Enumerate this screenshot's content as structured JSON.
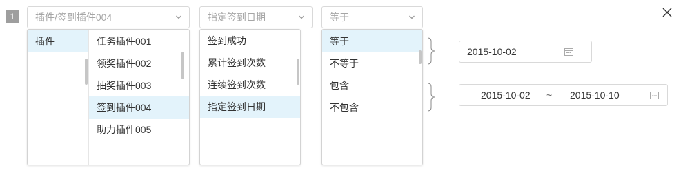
{
  "row": {
    "index": "1"
  },
  "field_select": {
    "value": "插件/签到插件004"
  },
  "field_dropdown": {
    "categories": [
      {
        "label": "插件"
      }
    ],
    "plugins": [
      {
        "label": "任务插件001"
      },
      {
        "label": "领奖插件002"
      },
      {
        "label": "抽奖插件003"
      },
      {
        "label": "签到插件004",
        "selected": true
      },
      {
        "label": "助力插件005"
      }
    ]
  },
  "attr_select": {
    "value": "指定签到日期"
  },
  "attr_dropdown": {
    "options": [
      {
        "label": "签到成功"
      },
      {
        "label": "累计签到次数"
      },
      {
        "label": "连续签到次数"
      },
      {
        "label": "指定签到日期",
        "selected": true
      }
    ]
  },
  "op_select": {
    "value": "等于"
  },
  "op_dropdown": {
    "options": [
      {
        "label": "等于",
        "selected": true
      },
      {
        "label": "不等于"
      },
      {
        "label": "包含"
      },
      {
        "label": "不包含"
      }
    ]
  },
  "single_date": {
    "value": "2015-10-02"
  },
  "date_range": {
    "start": "2015-10-02",
    "separator": "~",
    "end": "2015-10-10"
  },
  "icons": {
    "dropdown_arrow": "chevron-down-icon",
    "calendar": "calendar-icon",
    "close": "close-icon",
    "brace": "curly-brace-icon"
  },
  "colors": {
    "selected_bg": "#e3f3fb",
    "border": "#d9d9d9",
    "placeholder_text": "#a6a6a6",
    "badge_bg": "#9e9e9e"
  }
}
